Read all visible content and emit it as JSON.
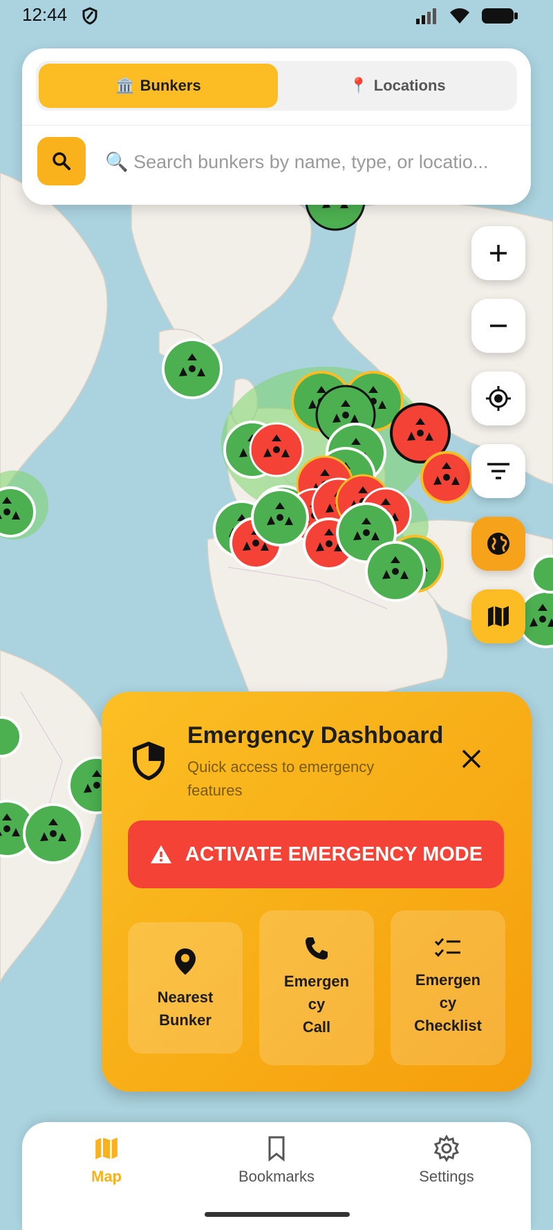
{
  "status": {
    "time": "12:44"
  },
  "tabs": [
    {
      "icon": "🏛️",
      "label": "Bunkers",
      "active": true
    },
    {
      "icon": "📍",
      "label": "Locations",
      "active": false
    }
  ],
  "search": {
    "placeholder": "🔍 Search bunkers by name, type, or locatio..."
  },
  "map_controls": [
    "zoom-in",
    "zoom-out",
    "my-location",
    "filter",
    "globe",
    "map-style"
  ],
  "emergency": {
    "title": "Emergency Dashboard",
    "subtitle": "Quick access to emergency features",
    "activate_label": "ACTIVATE EMERGENCY MODE",
    "actions": [
      {
        "label": "Nearest\nBunker",
        "icon": "location-pin-icon"
      },
      {
        "label": "Emergen\ncy\nCall",
        "icon": "phone-icon"
      },
      {
        "label": "Emergen\ncy\nChecklist",
        "icon": "checklist-icon"
      }
    ]
  },
  "nav": [
    {
      "label": "Map",
      "icon": "map-icon",
      "active": true
    },
    {
      "label": "Bookmarks",
      "icon": "bookmark-icon",
      "active": false
    },
    {
      "label": "Settings",
      "icon": "gear-icon",
      "active": false
    }
  ],
  "colors": {
    "accent": "#fbbd23",
    "danger": "#f44336",
    "marker_green": "#4caf50",
    "marker_red": "#f44336",
    "water": "#aad3df",
    "land": "#f2efe9"
  }
}
